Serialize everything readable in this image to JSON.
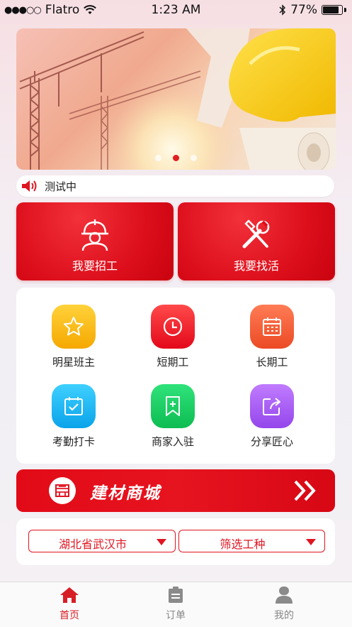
{
  "status_bar": {
    "carrier": "Flatro",
    "signal_dots": "●●●○○",
    "time": "1:23 AM",
    "battery": "77%",
    "battery_level": 0.77
  },
  "banner": {
    "slide_count": 3,
    "active_slide": 2
  },
  "notice": {
    "text": "测试中"
  },
  "actions": {
    "hire_label": "我要招工",
    "find_work_label": "我要找活"
  },
  "grid": {
    "items": [
      {
        "label": "明星班主",
        "icon": "star-icon",
        "color": "#f7b213"
      },
      {
        "label": "短期工",
        "icon": "clock-icon",
        "color": "#ef1e26"
      },
      {
        "label": "长期工",
        "icon": "calendar-icon",
        "color": "#f05d35"
      },
      {
        "label": "考勤打卡",
        "icon": "checkin-icon",
        "color": "#16b2ef"
      },
      {
        "label": "商家入驻",
        "icon": "bookmark-add-icon",
        "color": "#16cc5e"
      },
      {
        "label": "分享匠心",
        "icon": "share-icon",
        "color": "#a65df0"
      }
    ]
  },
  "mall": {
    "title": "建材商城"
  },
  "filters": {
    "region": "湖北省武汉市",
    "trade": "筛选工种"
  },
  "tabbar": {
    "home": "首页",
    "orders": "订单",
    "mine": "我的"
  },
  "colors": {
    "accent": "#e01522",
    "tab_active": "#d81e25",
    "tab_inactive": "#888888"
  }
}
